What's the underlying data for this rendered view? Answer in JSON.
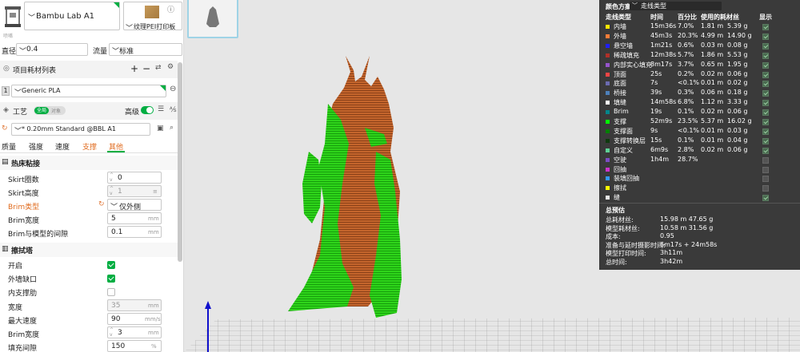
{
  "printer": {
    "name": "Bambu Lab A1",
    "plate": "纹理PEI打印板",
    "info_icon": "ⓘ"
  },
  "nozzle": {
    "section": "喷嘴",
    "diameter_label": "直径",
    "diameter_value": "0.4",
    "flow_label": "流量",
    "flow_value": "标准"
  },
  "filament": {
    "title": "项目耗材列表",
    "slot": "1",
    "name": "Generic PLA"
  },
  "process": {
    "title": "工艺",
    "toggle_all": "全局",
    "toggle_obj": "对象",
    "advanced": "高级",
    "preset": "* 0.20mm Standard @BBL A1",
    "tabs": [
      "质量",
      "强度",
      "速度",
      "支撑",
      "其他"
    ],
    "active_tab_index": 4,
    "highlight_tab_index": 3
  },
  "adhesion": {
    "title": "热床粘接",
    "skirt_loops_label": "Skirt圈数",
    "skirt_loops_value": "0",
    "skirt_height_label": "Skirt高度",
    "skirt_height_value": "1",
    "brim_type_label": "Brim类型",
    "brim_type_value": "仅外侧",
    "brim_width_label": "Brim宽度",
    "brim_width_value": "5",
    "brim_width_unit": "mm",
    "brim_gap_label": "Brim与模型的间隙",
    "brim_gap_value": "0.1",
    "brim_gap_unit": "mm"
  },
  "prime_tower": {
    "title": "擦拭塔",
    "enable_label": "开启",
    "enable_checked": true,
    "outer_gap_label": "外墙缺口",
    "outer_gap_checked": true,
    "inner_rib_label": "内支撑肋",
    "inner_rib_checked": false,
    "width_label": "宽度",
    "width_value": "35",
    "width_unit": "mm",
    "max_speed_label": "最大速度",
    "max_speed_value": "90",
    "max_speed_unit": "mm/s",
    "brim_width_label": "Brim宽度",
    "brim_width_value": "3",
    "brim_width_unit": "mm",
    "infill_gap_label": "填充间隙",
    "infill_gap_value": "150",
    "infill_gap_unit": "%"
  },
  "stats": {
    "title": "颜色方案",
    "scheme": "走线类型",
    "headers": [
      "走线类型",
      "时间",
      "百分比",
      "使用的耗材丝",
      "显示"
    ],
    "rows": [
      {
        "name": "内墙",
        "color": "#ffe600",
        "time": "15m36s",
        "pct": "7.0%",
        "len": "1.81 m",
        "wt": "5.39 g",
        "show": true
      },
      {
        "name": "外墙",
        "color": "#ff7d38",
        "time": "45m3s",
        "pct": "20.3%",
        "len": "4.99 m",
        "wt": "14.90 g",
        "show": true
      },
      {
        "name": "悬空墙",
        "color": "#1f1fff",
        "time": "1m21s",
        "pct": "0.6%",
        "len": "0.03 m",
        "wt": "0.08 g",
        "show": true
      },
      {
        "name": "稀疏填充",
        "color": "#b03029",
        "time": "12m38s",
        "pct": "5.7%",
        "len": "1.86 m",
        "wt": "5.53 g",
        "show": true
      },
      {
        "name": "内部实心填充",
        "color": "#9654cc",
        "time": "8m17s",
        "pct": "3.7%",
        "len": "0.65 m",
        "wt": "1.95 g",
        "show": true
      },
      {
        "name": "顶面",
        "color": "#f04545",
        "time": "25s",
        "pct": "0.2%",
        "len": "0.02 m",
        "wt": "0.06 g",
        "show": true
      },
      {
        "name": "底面",
        "color": "#6b6bb0",
        "time": "7s",
        "pct": "<0.1%",
        "len": "0.01 m",
        "wt": "0.02 g",
        "show": true
      },
      {
        "name": "桥接",
        "color": "#4d80ba",
        "time": "39s",
        "pct": "0.3%",
        "len": "0.06 m",
        "wt": "0.18 g",
        "show": true
      },
      {
        "name": "填缝",
        "color": "#ffffff",
        "time": "14m58s",
        "pct": "6.8%",
        "len": "1.12 m",
        "wt": "3.33 g",
        "show": true
      },
      {
        "name": "Brim",
        "color": "#00868b",
        "time": "19s",
        "pct": "0.1%",
        "len": "0.02 m",
        "wt": "0.06 g",
        "show": true
      },
      {
        "name": "支撑",
        "color": "#00ff00",
        "time": "52m9s",
        "pct": "23.5%",
        "len": "5.37 m",
        "wt": "16.02 g",
        "show": true
      },
      {
        "name": "支撑面",
        "color": "#008000",
        "time": "9s",
        "pct": "<0.1%",
        "len": "0.01 m",
        "wt": "0.03 g",
        "show": true
      },
      {
        "name": "支撑转换层",
        "color": "#0e3a0e",
        "time": "15s",
        "pct": "0.1%",
        "len": "0.01 m",
        "wt": "0.04 g",
        "show": true
      },
      {
        "name": "自定义",
        "color": "#5ed195",
        "time": "6m9s",
        "pct": "2.8%",
        "len": "0.02 m",
        "wt": "0.06 g",
        "show": true
      },
      {
        "name": "空驶",
        "color": "#7c4cc4",
        "time": "1h4m",
        "pct": "28.7%",
        "len": "",
        "wt": "",
        "show": false
      },
      {
        "name": "回抽",
        "color": "#cc33cc",
        "time": "",
        "pct": "",
        "len": "",
        "wt": "",
        "show": false
      },
      {
        "name": "装填回抽",
        "color": "#3399ff",
        "time": "",
        "pct": "",
        "len": "",
        "wt": "",
        "show": false
      },
      {
        "name": "擦拭",
        "color": "#ffff00",
        "time": "",
        "pct": "",
        "len": "",
        "wt": "",
        "show": false
      },
      {
        "name": "缝",
        "color": "#e8e8e8",
        "time": "",
        "pct": "",
        "len": "",
        "wt": "",
        "show": true
      }
    ],
    "totals_title": "总预估",
    "totals": [
      {
        "label": "总耗材丝:",
        "value": "15.98 m    47.65 g"
      },
      {
        "label": "模型耗材丝:",
        "value": "10.58 m    31.56 g"
      },
      {
        "label": "成本:",
        "value": "0.95"
      },
      {
        "label": "准备与延时摄影时间:",
        "value": "6m17s + 24m58s"
      },
      {
        "label": "模型打印时间:",
        "value": "3h11m"
      },
      {
        "label": "总时间:",
        "value": "3h42m"
      }
    ]
  }
}
